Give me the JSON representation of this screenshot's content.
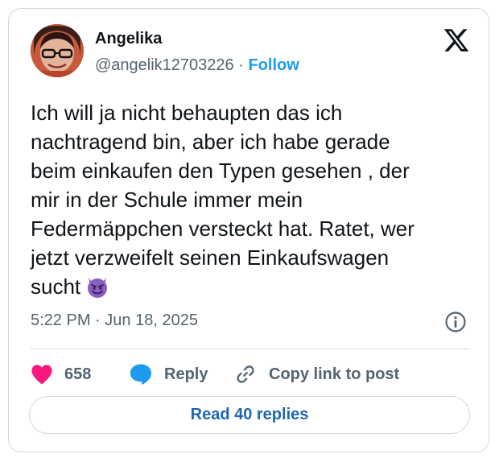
{
  "author": {
    "name": "Angelika",
    "handle": "@angelik12703226",
    "separator": "·",
    "follow_label": "Follow"
  },
  "tweet": {
    "lines": [
      "Ich will ja nicht behaupten das ich",
      "nachtragend bin, aber ich habe gerade",
      "beim einkaufen den Typen gesehen , der",
      "mir in der Schule immer mein",
      "Federmäppchen versteckt hat. Ratet, wer",
      "jetzt verzweifelt seinen Einkaufswagen",
      "sucht"
    ],
    "emoji": "smiling-face-with-horns"
  },
  "meta": {
    "time": "5:22 PM",
    "separator": "·",
    "date": "Jun 18, 2025"
  },
  "actions": {
    "like_count": "658",
    "reply_label": "Reply",
    "copy_label": "Copy link to post"
  },
  "read_replies_label": "Read 40 replies",
  "colors": {
    "accent": "#1d9bf0",
    "like": "#f91880",
    "text": "#0f1419",
    "secondary": "#536471",
    "border": "#cfd9de",
    "emoji": "#8b5fbf"
  },
  "icons": [
    "x-logo-icon",
    "info-icon",
    "heart-icon",
    "reply-bubble-icon",
    "link-icon",
    "devil-emoji-icon"
  ]
}
